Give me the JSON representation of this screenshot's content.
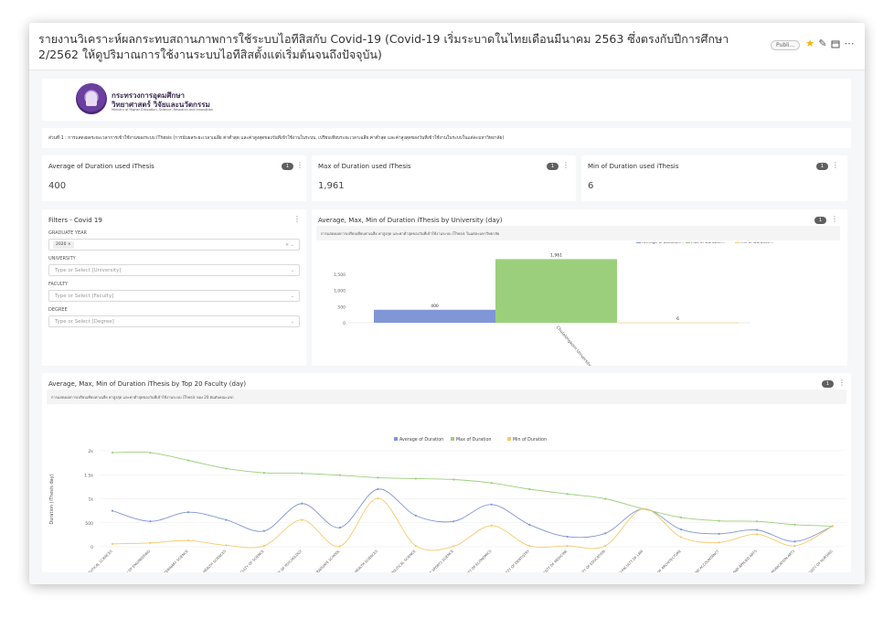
{
  "header": {
    "title": "รายงานวิเคราะห์ผลกระทบสถานภาพการใช้ระบบไอทีสิสกับ Covid-19 (Covid-19 เริ่มระบาดในไทยเดือนมีนาคม 2563 ซึ่งตรงกับปีการศึกษา 2/2562 ให้ดูปริมาณการใช้งานระบบไอทีสิสตั้งแต่เริ่มต้นจนถึงปัจจุบัน)",
    "publish_badge": "Publi...",
    "icons": [
      "star-icon",
      "edit-icon",
      "calendar-icon",
      "more-icon"
    ],
    "star_color": "#f5b400"
  },
  "logo": {
    "line1": "กระทรวงการอุดมศึกษา",
    "line2": "วิทยาศาสตร์ วิจัยและนวัตกรรม",
    "line3": "Ministry of Higher Education, Science, Research and Innovation"
  },
  "section": {
    "text": "ส่วนที่ 1 : การแสดงผลระยะเวลาการเข้าใช้งานของระบบ iThesis (การนับผลระยะเวลาเฉลี่ย ค่าต่ำสุด และค่าสูงสุดของวันที่เข้าใช้งานในระบบ, เปรียบเทียบระยะเวลาเฉลี่ย ค่าต่ำสุด และค่าสูงสุดของวันที่เข้าใช้งานในระบบในแต่ละมหาวิทยาลัย)"
  },
  "metrics": [
    {
      "title": "Average of Duration used iThesis",
      "value": "400",
      "badge": "1"
    },
    {
      "title": "Max of Duration used iThesis",
      "value": "1,961",
      "badge": "1"
    },
    {
      "title": "Min of Duration used iThesis",
      "value": "6",
      "badge": "1"
    }
  ],
  "filters": {
    "title": "Filters - Covid 19",
    "graduate_year_label": "GRADUATE YEAR",
    "graduate_year_value": "2020",
    "university_label": "UNIVERSITY",
    "university_placeholder": "Type or Select [University]",
    "faculty_label": "FACULTY",
    "faculty_placeholder": "Type or Select [Faculty]",
    "degree_label": "DEGREE",
    "degree_placeholder": "Type or Select [Degree]"
  },
  "colors": {
    "average": "#8096d6",
    "max": "#9ccf7c",
    "min": "#f7c96e"
  },
  "chart_data": [
    {
      "type": "bar",
      "title": "Average, Max, Min of Duration iThesis by University (day)",
      "description": "การแสดงผลการเปรียบเทียบค่าเฉลี่ย ค่าสูงสุด และค่าต่ำสุดของวันที่เข้าใช้งานระบบ iThesis ในแต่ละมหาวิทยาลัย",
      "badge": "1",
      "categories": [
        "Chulalongkorn University"
      ],
      "series": [
        {
          "name": "Average of Duration",
          "values": [
            400
          ],
          "color": "#8096d6"
        },
        {
          "name": "Max of Duration",
          "values": [
            1961
          ],
          "color": "#9ccf7c"
        },
        {
          "name": "Min of Duration",
          "values": [
            6
          ],
          "color": "#f7c96e"
        }
      ],
      "legend": [
        "Average of Duration...",
        "Max of Duration...",
        "Min of Duration..."
      ],
      "data_labels": [
        "400",
        "1,961",
        "6"
      ],
      "yticks": [
        "0",
        "500",
        "1,000",
        "1,500"
      ],
      "ylim": [
        0,
        2000
      ],
      "legend_position": "top-right"
    },
    {
      "type": "line",
      "title": "Average, Max, Min of Duration iThesis by Top 20 Faculty (day)",
      "description": "การแสดงผลการเปรียบเทียบค่าเฉลี่ย ค่าสูงสุด และค่าต่ำสุดของวันที่เข้าใช้งานระบบ iThesis ของ 20 อันดับคณะแรก",
      "badge": "1",
      "ylabel": "Duration (iThesis day)",
      "yticks": [
        "0",
        "500",
        "1k",
        "1.5k",
        "2k"
      ],
      "ylim": [
        0,
        2000
      ],
      "legend_position": "top",
      "categories": [
        "CU-FACULTY OF PHARMACEUTICAL SCIENCES",
        "CU-FACULTY OF ENGINEERING",
        "CU-FACULTY OF VETERINARY SCIENCE",
        "CU-COLLEGE OF PUBLIC HEALTH SCIENCES",
        "CU-FACULTY OF SCIENCE",
        "CU-FACULTY OF PSYCHOLOGY",
        "CU-GRADUATE SCHOOL",
        "CU-FACULTY OF ALLIED HEALTH SCIENCES",
        "CU-FACULTY OF POLITICAL SCIENCE",
        "CU-FACULTY OF SPORTS SCIENCE",
        "CU-FACULTY OF ECONOMICS",
        "CU-FACULTY OF DENTISTRY",
        "CU-FACULTY OF MEDICINE",
        "CU-FACULTY OF EDUCATION",
        "CU-FACULTY OF LAW",
        "CU-FACULTY OF ARCHITECTURE",
        "CU-FACULTY OF COMMERCE AND ACCOUNTANCY",
        "CU-FACULTY OF FINE AND APPLIED ARTS",
        "CU-FACULTY OF COMMUNICATION ARTS",
        "CU-FACULTY OF NURSING"
      ],
      "series": [
        {
          "name": "Average of Duration",
          "color": "#8096d6",
          "values": [
            750,
            530,
            720,
            560,
            330,
            900,
            400,
            1200,
            650,
            530,
            880,
            460,
            210,
            280,
            790,
            360,
            270,
            350,
            110,
            430
          ]
        },
        {
          "name": "Max of Duration",
          "color": "#9ccf7c",
          "values": [
            1961,
            1961,
            1800,
            1630,
            1540,
            1530,
            1490,
            1440,
            1420,
            1400,
            1330,
            1200,
            1100,
            1000,
            790,
            610,
            540,
            530,
            460,
            430
          ]
        },
        {
          "name": "Min of Duration",
          "color": "#f7c96e",
          "values": [
            60,
            80,
            130,
            30,
            20,
            560,
            10,
            1010,
            20,
            10,
            440,
            20,
            20,
            20,
            790,
            200,
            90,
            260,
            20,
            430
          ]
        }
      ]
    }
  ]
}
